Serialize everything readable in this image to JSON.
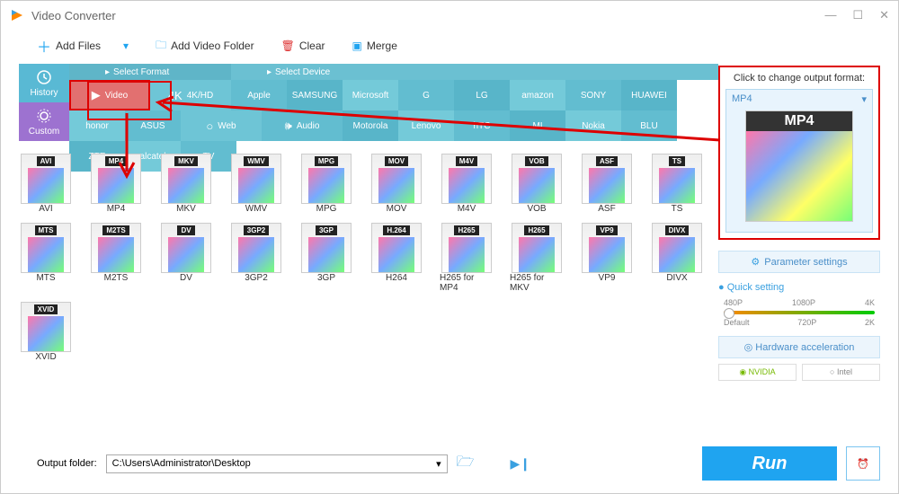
{
  "app": {
    "title": "Video Converter"
  },
  "toolbar": {
    "add_files": "Add Files",
    "add_folder": "Add Video Folder",
    "clear": "Clear",
    "merge": "Merge"
  },
  "sidetabs": {
    "history": "History",
    "custom": "Custom"
  },
  "headers": {
    "format": "Select Format",
    "device": "Select Device"
  },
  "formats": {
    "video": "Video",
    "hd": "4K/HD",
    "web": "Web",
    "audio": "Audio"
  },
  "brands": [
    "Apple",
    "SAMSUNG",
    "Microsoft",
    "G",
    "LG",
    "amazon",
    "SONY",
    "HUAWEI",
    "honor",
    "ASUS",
    "Motorola",
    "Lenovo",
    "hTC",
    "MI",
    "Nokia",
    "BLU",
    "ZTE",
    "alcatel",
    "TV"
  ],
  "grid": [
    {
      "tag": "AVI",
      "label": "AVI"
    },
    {
      "tag": "MP4",
      "label": "MP4"
    },
    {
      "tag": "MKV",
      "label": "MKV"
    },
    {
      "tag": "WMV",
      "label": "WMV"
    },
    {
      "tag": "MPG",
      "label": "MPG"
    },
    {
      "tag": "MOV",
      "label": "MOV"
    },
    {
      "tag": "M4V",
      "label": "M4V"
    },
    {
      "tag": "VOB",
      "label": "VOB"
    },
    {
      "tag": "ASF",
      "label": "ASF"
    },
    {
      "tag": "TS",
      "label": "TS"
    },
    {
      "tag": "MTS",
      "label": "MTS"
    },
    {
      "tag": "M2TS",
      "label": "M2TS"
    },
    {
      "tag": "DV",
      "label": "DV"
    },
    {
      "tag": "3GP2",
      "label": "3GP2"
    },
    {
      "tag": "3GP",
      "label": "3GP"
    },
    {
      "tag": "H.264",
      "label": "H264"
    },
    {
      "tag": "H265",
      "label": "H265 for MP4"
    },
    {
      "tag": "H265",
      "label": "H265 for MKV"
    },
    {
      "tag": "VP9",
      "label": "VP9"
    },
    {
      "tag": "DIVX",
      "label": "DIVX"
    },
    {
      "tag": "XVID",
      "label": "XVID"
    }
  ],
  "output": {
    "prompt": "Click to change output format:",
    "selected": "MP4",
    "tag": "MP4"
  },
  "param_btn": "Parameter settings",
  "quick": {
    "title": "Quick setting",
    "top": [
      "480P",
      "1080P",
      "4K"
    ],
    "bot": [
      "Default",
      "720P",
      "2K"
    ]
  },
  "hw": "Hardware acceleration",
  "gpu": {
    "nvidia": "NVIDIA",
    "intel": "Intel"
  },
  "footer": {
    "label": "Output folder:",
    "path": "C:\\Users\\Administrator\\Desktop",
    "run": "Run"
  }
}
